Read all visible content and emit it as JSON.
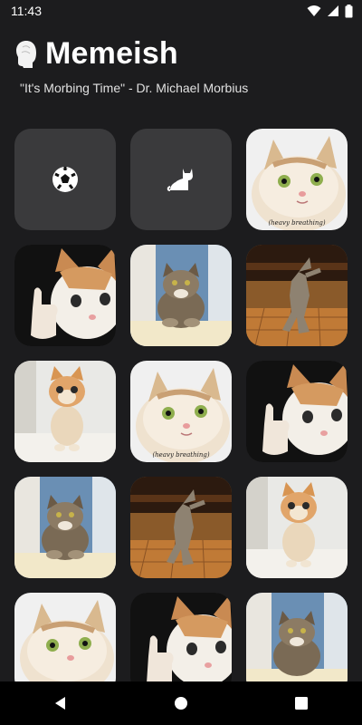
{
  "status_bar": {
    "time": "11:43"
  },
  "header": {
    "title": "Memeish",
    "subtitle": "\"It's Morbing Time\" - Dr. Michael Morbius"
  },
  "category_tiles": [
    {
      "icon": "soccer-ball-icon"
    },
    {
      "icon": "cat-icon"
    }
  ],
  "meme_tiles": [
    {
      "meme": "heavy-breathing-cat",
      "caption": "(heavy breathing)"
    },
    {
      "meme": "thumbs-up-crying-cat"
    },
    {
      "meme": "sitting-tabby-cat"
    },
    {
      "meme": "dancing-cat"
    },
    {
      "meme": "standing-kitten"
    },
    {
      "meme": "heavy-breathing-cat",
      "caption": "(heavy breathing)"
    },
    {
      "meme": "thumbs-up-crying-cat"
    },
    {
      "meme": "sitting-tabby-cat"
    },
    {
      "meme": "dancing-cat"
    },
    {
      "meme": "standing-kitten"
    },
    {
      "meme": "heavy-breathing-cat"
    },
    {
      "meme": "thumbs-up-crying-cat"
    },
    {
      "meme": "sitting-tabby-cat"
    }
  ],
  "colors": {
    "background": "#1c1c1e",
    "tile": "#3a3a3c",
    "nav": "#000000"
  }
}
